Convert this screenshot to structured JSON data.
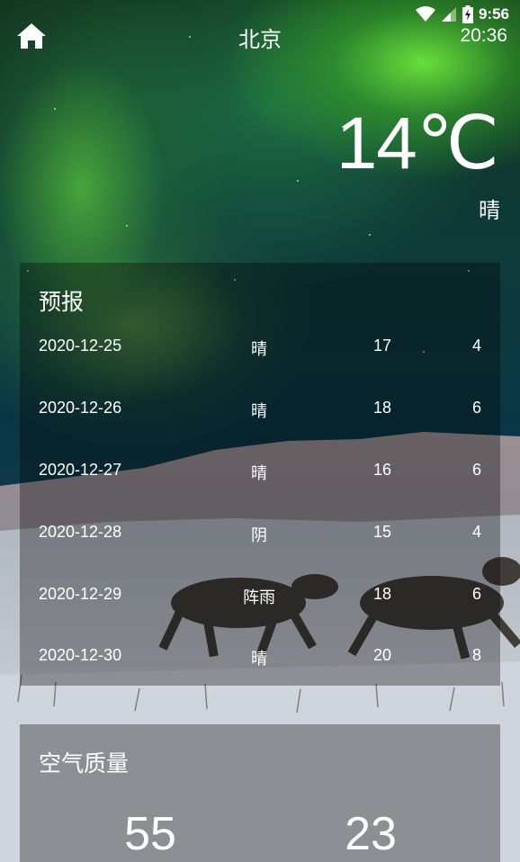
{
  "status_bar": {
    "time": "9:56",
    "icons": [
      "wifi-icon",
      "signal-icon",
      "battery-charging-icon"
    ]
  },
  "header": {
    "home_icon": "home-icon",
    "city": "北京",
    "update_time": "20:36"
  },
  "now": {
    "temperature": "14℃",
    "info": "晴"
  },
  "forecast": {
    "title": "预报",
    "items": [
      {
        "date": "2020-12-25",
        "info": "晴",
        "max": "17",
        "min": "4"
      },
      {
        "date": "2020-12-26",
        "info": "晴",
        "max": "18",
        "min": "6"
      },
      {
        "date": "2020-12-27",
        "info": "晴",
        "max": "16",
        "min": "6"
      },
      {
        "date": "2020-12-28",
        "info": "阴",
        "max": "15",
        "min": "4"
      },
      {
        "date": "2020-12-29",
        "info": "阵雨",
        "max": "18",
        "min": "6"
      },
      {
        "date": "2020-12-30",
        "info": "晴",
        "max": "20",
        "min": "8"
      }
    ]
  },
  "aqi": {
    "title": "空气质量",
    "aqi_value": "55",
    "pm25_value": "23"
  }
}
